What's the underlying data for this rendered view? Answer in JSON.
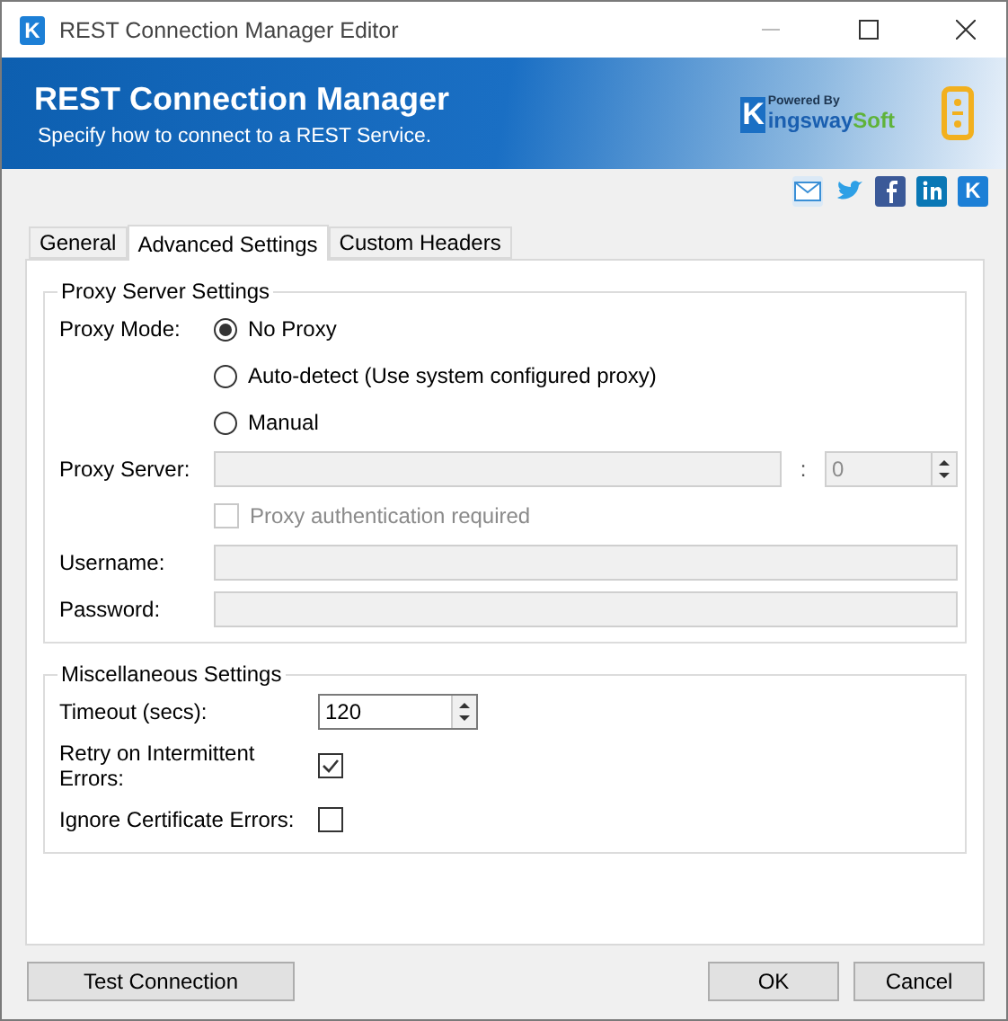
{
  "window": {
    "icon_letter": "K",
    "title": "REST Connection Manager Editor"
  },
  "banner": {
    "title": "REST Connection Manager",
    "subtitle": "Specify how to connect to a REST Service.",
    "logo": {
      "letter": "K",
      "powered_by": "Powered By",
      "name_a": "ingsway",
      "name_b": "Soft"
    }
  },
  "social_icons": [
    {
      "kind": "mail"
    },
    {
      "kind": "twitter"
    },
    {
      "kind": "facebook"
    },
    {
      "kind": "linkedin"
    },
    {
      "kind": "brand",
      "letter": "K"
    }
  ],
  "tabs": [
    {
      "label": "General",
      "selected": false
    },
    {
      "label": "Advanced Settings",
      "selected": true
    },
    {
      "label": "Custom Headers",
      "selected": false
    }
  ],
  "proxy": {
    "legend": "Proxy Server Settings",
    "mode_label": "Proxy Mode:",
    "modes": [
      {
        "label": "No Proxy",
        "selected": true
      },
      {
        "label": "Auto-detect (Use system configured proxy)",
        "selected": false
      },
      {
        "label": "Manual",
        "selected": false
      }
    ],
    "server_label": "Proxy Server:",
    "server_disabled": true,
    "port_separator": ":",
    "port_value": "0",
    "auth": {
      "label": "Proxy authentication required",
      "checked": false,
      "disabled": true
    },
    "username_label": "Username:",
    "password_label": "Password:"
  },
  "misc": {
    "legend": "Miscellaneous Settings",
    "timeout_label": "Timeout (secs):",
    "timeout_value": "120",
    "checks": [
      {
        "label": "Retry on Intermittent Errors:",
        "checked": true
      },
      {
        "label": "Ignore Certificate Errors:",
        "checked": false
      }
    ]
  },
  "buttons": {
    "test": "Test Connection",
    "ok": "OK",
    "cancel": "Cancel"
  }
}
